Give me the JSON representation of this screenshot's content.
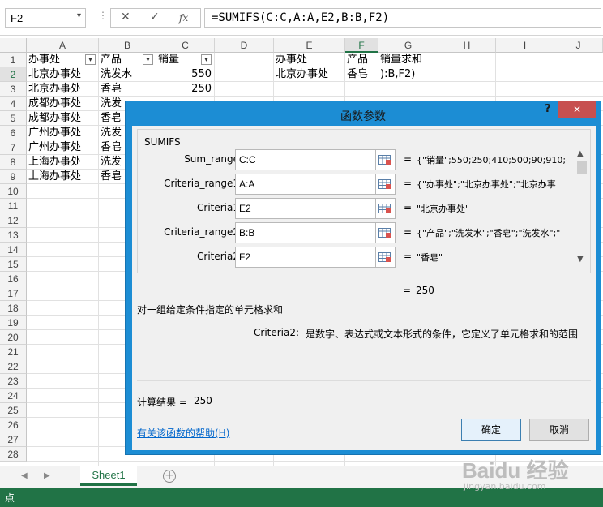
{
  "formula_bar": {
    "name_box": "F2",
    "name_box_arrow": "▾",
    "separator": "⋮",
    "cancel_icon": "✕",
    "enter_icon": "✓",
    "fx_icon": "fx",
    "formula": "=SUMIFS(C:C,A:A,E2,B:B,F2)"
  },
  "columns": [
    "A",
    "B",
    "C",
    "D",
    "E",
    "F",
    "G",
    "H",
    "I",
    "J"
  ],
  "rows": [
    "1",
    "2",
    "3",
    "4",
    "5",
    "6",
    "7",
    "8",
    "9",
    "10",
    "11",
    "12",
    "13",
    "14",
    "15",
    "16",
    "17",
    "18",
    "19",
    "20",
    "21",
    "22",
    "23",
    "24",
    "25",
    "26",
    "27",
    "28"
  ],
  "cells": {
    "A1": "办事处",
    "B1": "产品",
    "C1": "销量",
    "A2": "北京办事处",
    "B2": "洗发水",
    "C2": "550",
    "A3": "北京办事处",
    "B3": "香皂",
    "C3": "250",
    "A4": "成都办事处",
    "B4": "洗发",
    "A5": "成都办事处",
    "B5": "香皂",
    "A6": "广州办事处",
    "B6": "洗发",
    "A7": "广州办事处",
    "B7": "香皂",
    "A8": "上海办事处",
    "B8": "洗发",
    "A9": "上海办事处",
    "B9": "香皂",
    "E1": "办事处",
    "F1": "产品",
    "G1": "销量求和",
    "E2": "北京办事处",
    "F2": "香皂",
    "G2": "):B,F2)"
  },
  "filter_icon": "▾",
  "sheet_tabs": {
    "prev": "◀",
    "next": "▶",
    "active": "Sheet1",
    "add": "+"
  },
  "status_bar": {
    "mode": "点"
  },
  "watermark": {
    "logo": "Baidu 经验",
    "url": "jingyan.baidu.com"
  },
  "dialog": {
    "title": "函数参数",
    "help": "?",
    "close": "✕",
    "function_name": "SUMIFS",
    "arguments": [
      {
        "label": "Sum_range",
        "value": "C:C",
        "result": "{\"销量\";550;250;410;500;90;910;("
      },
      {
        "label": "Criteria_range1",
        "value": "A:A",
        "result": "{\"办事处\";\"北京办事处\";\"北京办事"
      },
      {
        "label": "Criteria1",
        "value": "E2",
        "result": "\"北京办事处\""
      },
      {
        "label": "Criteria_range2",
        "value": "B:B",
        "result": "{\"产品\";\"洗发水\";\"香皂\";\"洗发水\";\""
      },
      {
        "label": "Criteria2",
        "value": "F2",
        "result": "\"香皂\""
      }
    ],
    "equals": "=",
    "scroll_up": "▲",
    "scroll_down": "▼",
    "formula_result": "250",
    "description": "对一组给定条件指定的单元格求和",
    "arg_desc_label": "Criteria2:",
    "arg_desc_text": "是数字、表达式或文本形式的条件，它定义了单元格求和的范围",
    "calc_label": "计算结果 =",
    "calc_value": "250",
    "help_link": "有关该函数的帮助(H)",
    "ok": "确定",
    "cancel": "取消"
  }
}
